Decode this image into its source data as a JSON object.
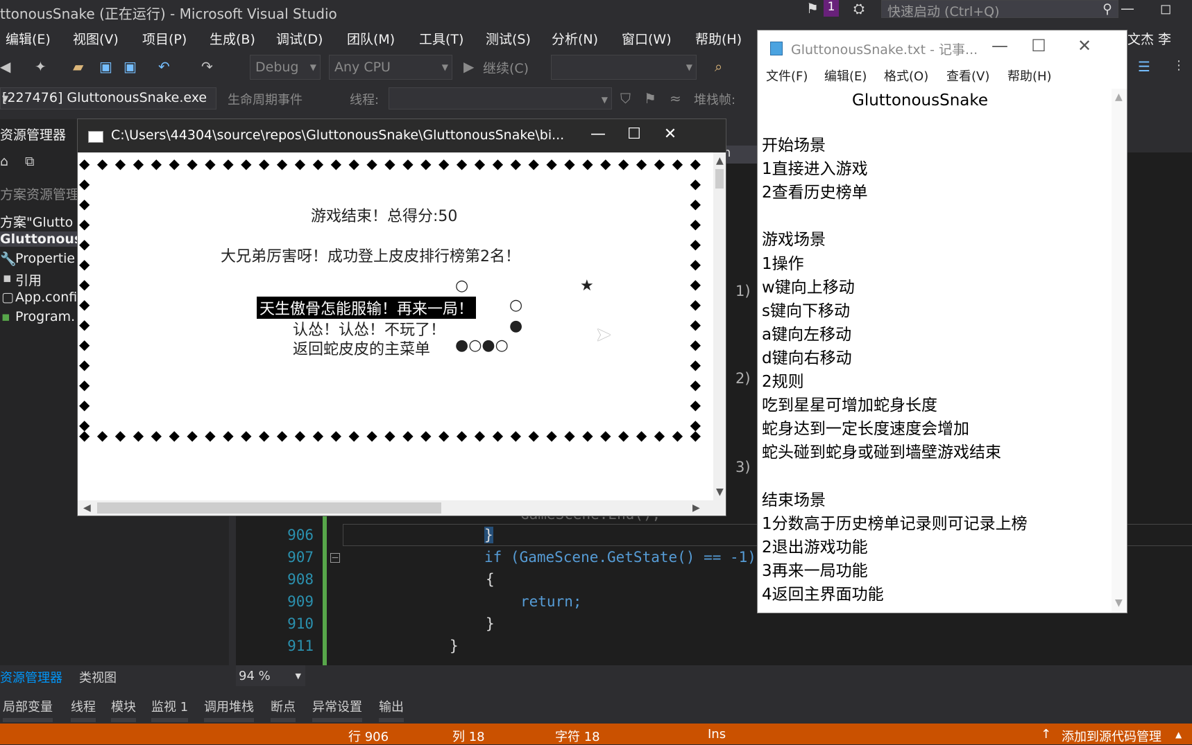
{
  "vs": {
    "title": "ttonousSnake (正在运行) - Microsoft Visual Studio",
    "quick_launch": "快速启动 (Ctrl+Q)",
    "notification_count": "1",
    "account": "文杰 李",
    "menu": [
      "编辑(E)",
      "视图(V)",
      "项目(P)",
      "生成(B)",
      "调试(D)",
      "团队(M)",
      "工具(T)",
      "测试(S)",
      "分析(N)",
      "窗口(W)",
      "帮助(H)"
    ],
    "toolbar": {
      "config": "Debug",
      "platform": "Any CPU",
      "continue": "继续(C)"
    },
    "debugbar": {
      "process": "[227476] GluttonousSnake.exe",
      "lifecycle": "生命周期事件",
      "thread": "线程:",
      "stackframe": "堆栈帧:"
    },
    "solution_explorer": {
      "header": "资源管理器",
      "search": "方案资源管理",
      "items": [
        "方案\"Glutto",
        "GluttonousS",
        "Propertie",
        "引用",
        "App.confi",
        "Program."
      ]
    },
    "code": {
      "tab_label": "gram",
      "line_numbers": [
        "906",
        "907",
        "908",
        "909",
        "910",
        "911"
      ],
      "lines": [
        "}",
        "if (GameScene.GetState() == -1)",
        "{",
        "return;",
        "}",
        "}"
      ],
      "hidden_line": "GameScene.End();",
      "margin_labels": [
        "1)",
        "2)",
        "3)"
      ]
    },
    "bottom": {
      "tabs1": [
        "资源管理器",
        "类视图"
      ],
      "zoom": "94 %",
      "tabs2": [
        "局部变量",
        "线程",
        "模块",
        "监视 1",
        "调用堆栈",
        "断点",
        "异常设置",
        "输出"
      ]
    },
    "status": {
      "line": "行 906",
      "col": "列 18",
      "char": "字符 18",
      "ins": "Ins",
      "source_control": "添加到源代码管理"
    }
  },
  "console": {
    "title": "C:\\Users\\44304\\source\\repos\\GluttonousSnake\\GluttonousSnake\\bi...",
    "game_over": "游戏结束！总得分:50",
    "rank_msg": "大兄弟厉害呀！成功登上皮皮排行榜第2名！",
    "options": [
      "天生傲骨怎能服输！再来一局！",
      "认怂！认怂！不玩了！",
      "返回蛇皮皮的主菜单"
    ],
    "star": "★"
  },
  "notepad": {
    "title": "GluttonousSnake.txt - 记事...",
    "menu": [
      "文件(F)",
      "编辑(E)",
      "格式(O)",
      "查看(V)",
      "帮助(H)"
    ],
    "heading": "GluttonousSnake",
    "lines": [
      "开始场景",
      "1直接进入游戏",
      "2查看历史榜单",
      "",
      "游戏场景",
      "1操作",
      "w键向上移动",
      "s键向下移动",
      "a键向左移动",
      "d键向右移动",
      "2规则",
      "吃到星星可增加蛇身长度",
      "蛇身达到一定长度速度会增加",
      "蛇头碰到蛇身或碰到墙壁游戏结束",
      "",
      "结束场景",
      "1分数高于历史榜单记录则可记录上榜",
      "2退出游戏功能",
      "3再来一局功能",
      "4返回主界面功能"
    ]
  }
}
